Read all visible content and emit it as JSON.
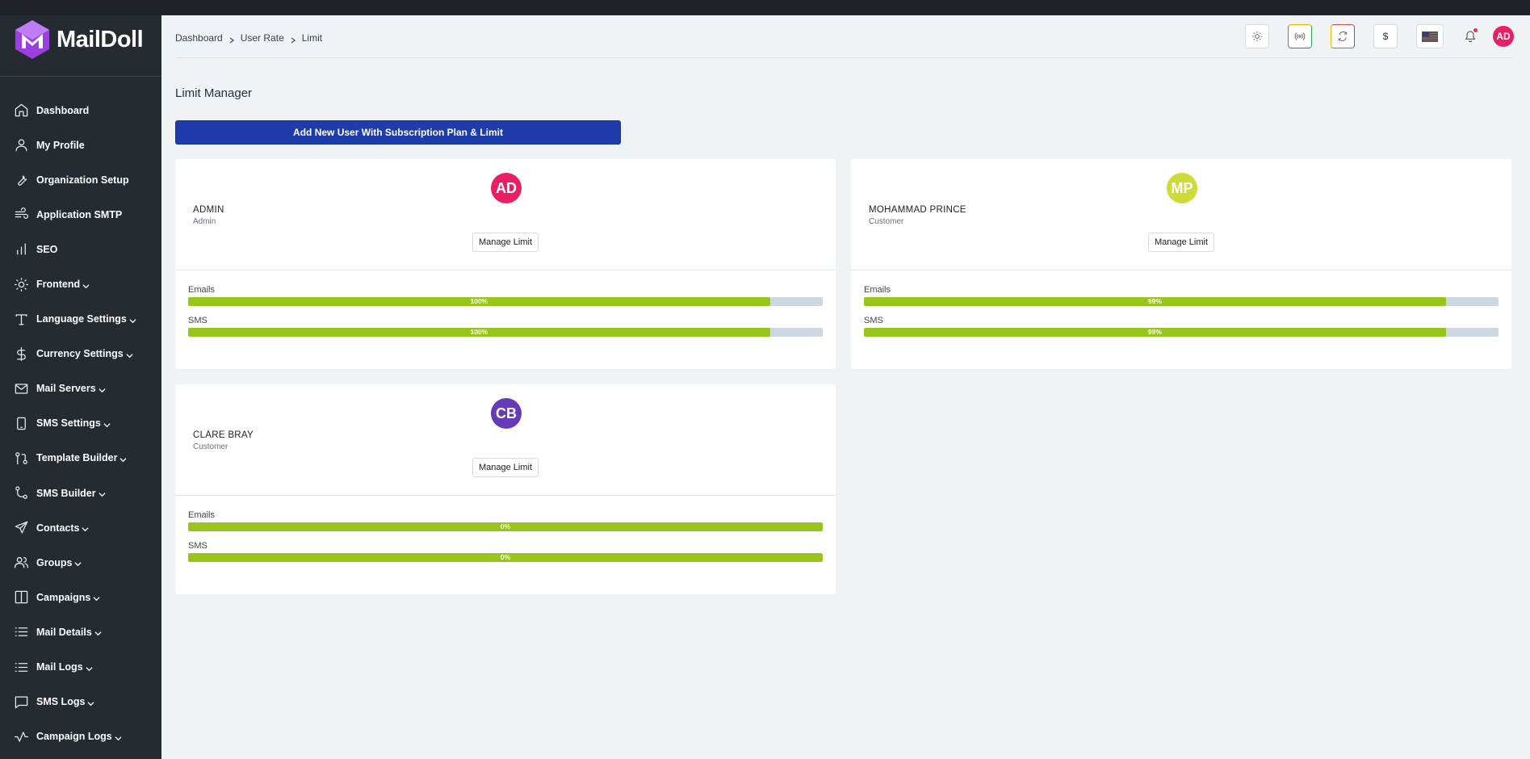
{
  "app": {
    "name": "MailDoll"
  },
  "sidebar": {
    "items": [
      {
        "label": "Dashboard",
        "icon": "home-icon",
        "expandable": false
      },
      {
        "label": "My Profile",
        "icon": "user-icon",
        "expandable": false
      },
      {
        "label": "Organization Setup",
        "icon": "wrench-icon",
        "expandable": false
      },
      {
        "label": "Application SMTP",
        "icon": "wind-icon",
        "expandable": false
      },
      {
        "label": "SEO",
        "icon": "bar-chart-icon",
        "expandable": false
      },
      {
        "label": "Frontend",
        "icon": "sun-icon",
        "expandable": true
      },
      {
        "label": "Language Settings",
        "icon": "type-icon",
        "expandable": true
      },
      {
        "label": "Currency Settings",
        "icon": "dollar-icon",
        "expandable": true
      },
      {
        "label": "Mail Servers",
        "icon": "mail-icon",
        "expandable": true
      },
      {
        "label": "SMS Settings",
        "icon": "phone-icon",
        "expandable": true
      },
      {
        "label": "Template Builder",
        "icon": "git-pull-request-icon",
        "expandable": true
      },
      {
        "label": "SMS Builder",
        "icon": "git-branch-icon",
        "expandable": true
      },
      {
        "label": "Contacts",
        "icon": "send-icon",
        "expandable": true
      },
      {
        "label": "Groups",
        "icon": "users-icon",
        "expandable": true
      },
      {
        "label": "Campaigns",
        "icon": "columns-icon",
        "expandable": true
      },
      {
        "label": "Mail Details",
        "icon": "list-icon",
        "expandable": true
      },
      {
        "label": "Mail Logs",
        "icon": "list-icon",
        "expandable": true
      },
      {
        "label": "SMS Logs",
        "icon": "message-square-icon",
        "expandable": true
      },
      {
        "label": "Campaign Logs",
        "icon": "activity-icon",
        "expandable": true
      }
    ]
  },
  "breadcrumb": [
    "Dashboard",
    "User Rate",
    "Limit"
  ],
  "toolbar": {
    "currency_symbol": "$",
    "user_initials": "AD",
    "flag": "us-flag-icon"
  },
  "page": {
    "title": "Limit Manager",
    "add_button": "Add New User With Subscription Plan & Limit"
  },
  "cards": [
    {
      "initials": "AD",
      "avatar_color": "#e91e63",
      "name": "ADMIN",
      "role": "Admin",
      "manage_label": "Manage Limit",
      "bars": [
        {
          "label": "Emails",
          "text": "100%",
          "fill": 0.917
        },
        {
          "label": "SMS",
          "text": "100%",
          "fill": 0.917
        }
      ]
    },
    {
      "initials": "MP",
      "avatar_color": "#cddc39",
      "name": "MOHAMMAD PRINCE",
      "role": "Customer",
      "manage_label": "Manage Limit",
      "bars": [
        {
          "label": "Emails",
          "text": "99%",
          "fill": 0.917
        },
        {
          "label": "SMS",
          "text": "99%",
          "fill": 0.917
        }
      ]
    },
    {
      "initials": "CB",
      "avatar_color": "#673ab7",
      "name": "CLARE BRAY",
      "role": "Customer",
      "manage_label": "Manage Limit",
      "bars": [
        {
          "label": "Emails",
          "text": "0%",
          "fill": 1.0
        },
        {
          "label": "SMS",
          "text": "0%",
          "fill": 1.0
        }
      ]
    }
  ]
}
